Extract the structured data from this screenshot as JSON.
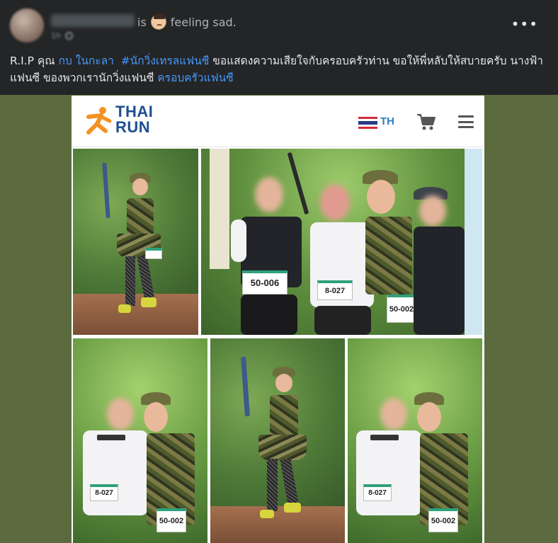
{
  "post": {
    "status_prefix": "is",
    "feeling": "feeling sad.",
    "text_prefix": "R.I.P คุณ ",
    "mention_name": "กบ ในกะลา",
    "hashtag": "#นักวิ่งเทรลแฟนซี",
    "text_middle": " ขอแสดงความเสียใจกับครอบครัวท่าน ขอให้พี่หลับให้สบายครับ นางฟ้าแฟนซี ของพวกเรานักวิ่งแฟนซี ",
    "group_link": "ครอบครัวแฟนซี"
  },
  "site": {
    "logo_line1": "THAI",
    "logo_line2": "RUN",
    "language": "TH"
  },
  "bibs": {
    "bib_group_1": "50-006",
    "bib_group_2": "8-027",
    "bib_group_3": "50-002",
    "bib_pair_left_1": "8-027",
    "bib_pair_right_1": "50-002",
    "bib_pair_left_2": "8-027",
    "bib_pair_right_2": "50-002"
  },
  "colors": {
    "background": "#242526",
    "link": "#4599ff",
    "image_backdrop": "#5c6b3e",
    "brand_blue": "#1e4f8f",
    "brand_orange": "#f39223"
  },
  "icons": [
    "more-icon",
    "globe-icon",
    "sad-emoji-icon",
    "thai-flag-icon",
    "cart-icon",
    "hamburger-menu-icon",
    "runner-logo-icon"
  ]
}
